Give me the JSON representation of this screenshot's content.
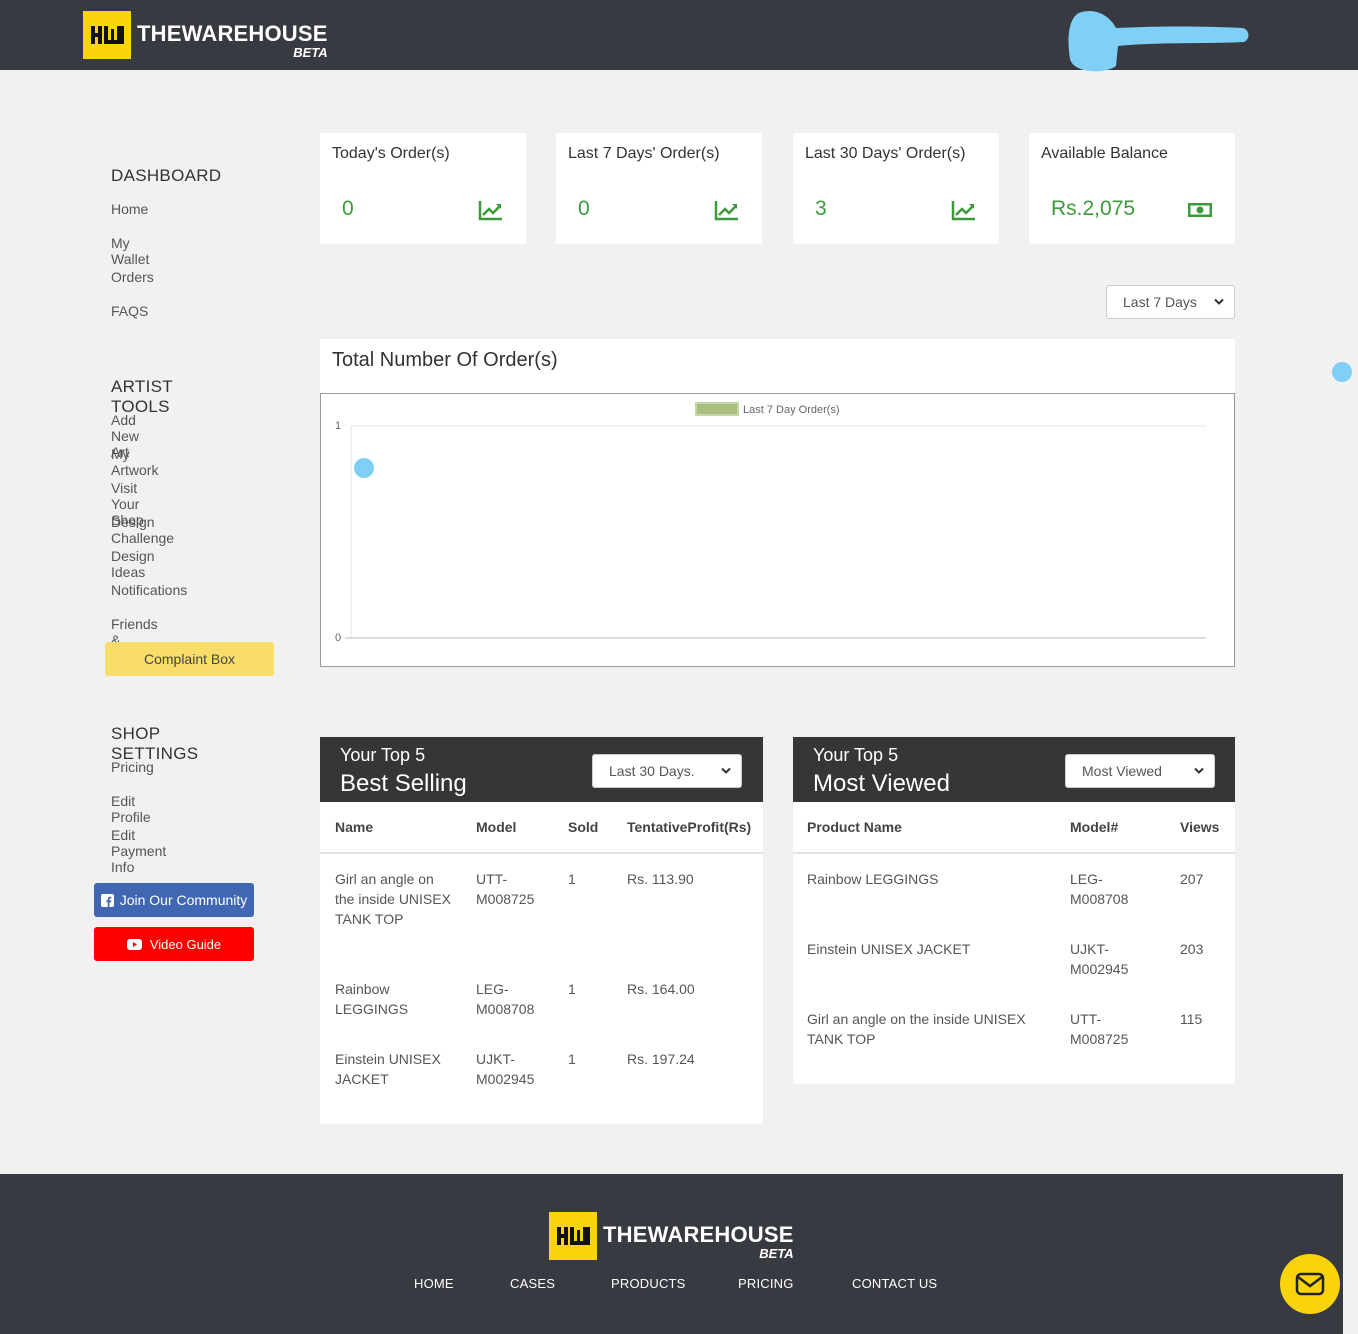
{
  "brand": {
    "name": "THEWAREHOUSE",
    "tag": "BETA",
    "mark": "HWH"
  },
  "sidebar": {
    "dashboard": {
      "title": "DASHBOARD",
      "items": [
        "Home",
        "My Wallet",
        "Orders",
        "FAQS"
      ]
    },
    "artist_tools": {
      "title": "ARTIST TOOLS",
      "items": [
        "Add New Art",
        "My Artwork",
        "Visit Your Shop",
        "Design Challenge",
        "Design Ideas",
        "Notifications",
        "Friends & Family"
      ],
      "complaint": "Complaint Box"
    },
    "shop_settings": {
      "title": "SHOP SETTINGS",
      "items": [
        "Pricing",
        "Edit Profile",
        "Edit Payment Info"
      ]
    },
    "community_btn": "Join Our Community",
    "video_btn": "Video Guide"
  },
  "stats": [
    {
      "label": "Today's Order(s)",
      "value": "0",
      "icon": "chart-line-icon"
    },
    {
      "label": "Last 7 Days' Order(s)",
      "value": "0",
      "icon": "chart-line-icon"
    },
    {
      "label": "Last 30 Days' Order(s)",
      "value": "3",
      "icon": "chart-line-icon"
    },
    {
      "label": "Available Balance",
      "value": "Rs.2,075",
      "icon": "money-icon"
    }
  ],
  "range_select": "Last 7 Days",
  "chart_panel": {
    "title": "Total Number Of Order(s)"
  },
  "chart_data": {
    "type": "line",
    "legend": "Last 7 Day Order(s)",
    "legend_color": "#a9bf7f",
    "y_ticks": [
      "1",
      "0"
    ],
    "ylim": [
      0,
      1
    ],
    "series": [
      {
        "name": "Last 7 Day Order(s)",
        "values": []
      }
    ]
  },
  "best_selling": {
    "small": "Your Top 5",
    "big": "Best Selling",
    "select": "Last 30 Days.",
    "columns": [
      "Name",
      "Model",
      "Sold",
      "TentativeProfit(Rs)"
    ],
    "rows": [
      {
        "name": "Girl an angle on the inside UNISEX TANK TOP",
        "model": "UTT-M008725",
        "sold": "1",
        "profit": "Rs. 113.90"
      },
      {
        "name": "Rainbow LEGGINGS",
        "model": "LEG-M008708",
        "sold": "1",
        "profit": "Rs. 164.00"
      },
      {
        "name": "Einstein UNISEX JACKET",
        "model": "UJKT-M002945",
        "sold": "1",
        "profit": "Rs. 197.24"
      }
    ]
  },
  "most_viewed": {
    "small": "Your Top 5",
    "big": "Most Viewed",
    "select": "Most Viewed",
    "columns": [
      "Product Name",
      "Model#",
      "Views"
    ],
    "rows": [
      {
        "name": "Rainbow LEGGINGS",
        "model": "LEG-M008708",
        "views": "207"
      },
      {
        "name": "Einstein UNISEX JACKET",
        "model": "UJKT-M002945",
        "views": "203"
      },
      {
        "name": "Girl an angle on the inside UNISEX TANK TOP",
        "model": "UTT-M008725",
        "views": "115"
      }
    ]
  },
  "footer": {
    "links": [
      "HOME",
      "CASES",
      "PRODUCTS",
      "PRICING",
      "CONTACT US"
    ]
  },
  "colors": {
    "accent": "#f9d40d",
    "header_bg": "#383a42",
    "green": "#3c9a3c",
    "complaint": "#f9dd6a",
    "community": "#4267b2",
    "video": "#ff0000"
  }
}
